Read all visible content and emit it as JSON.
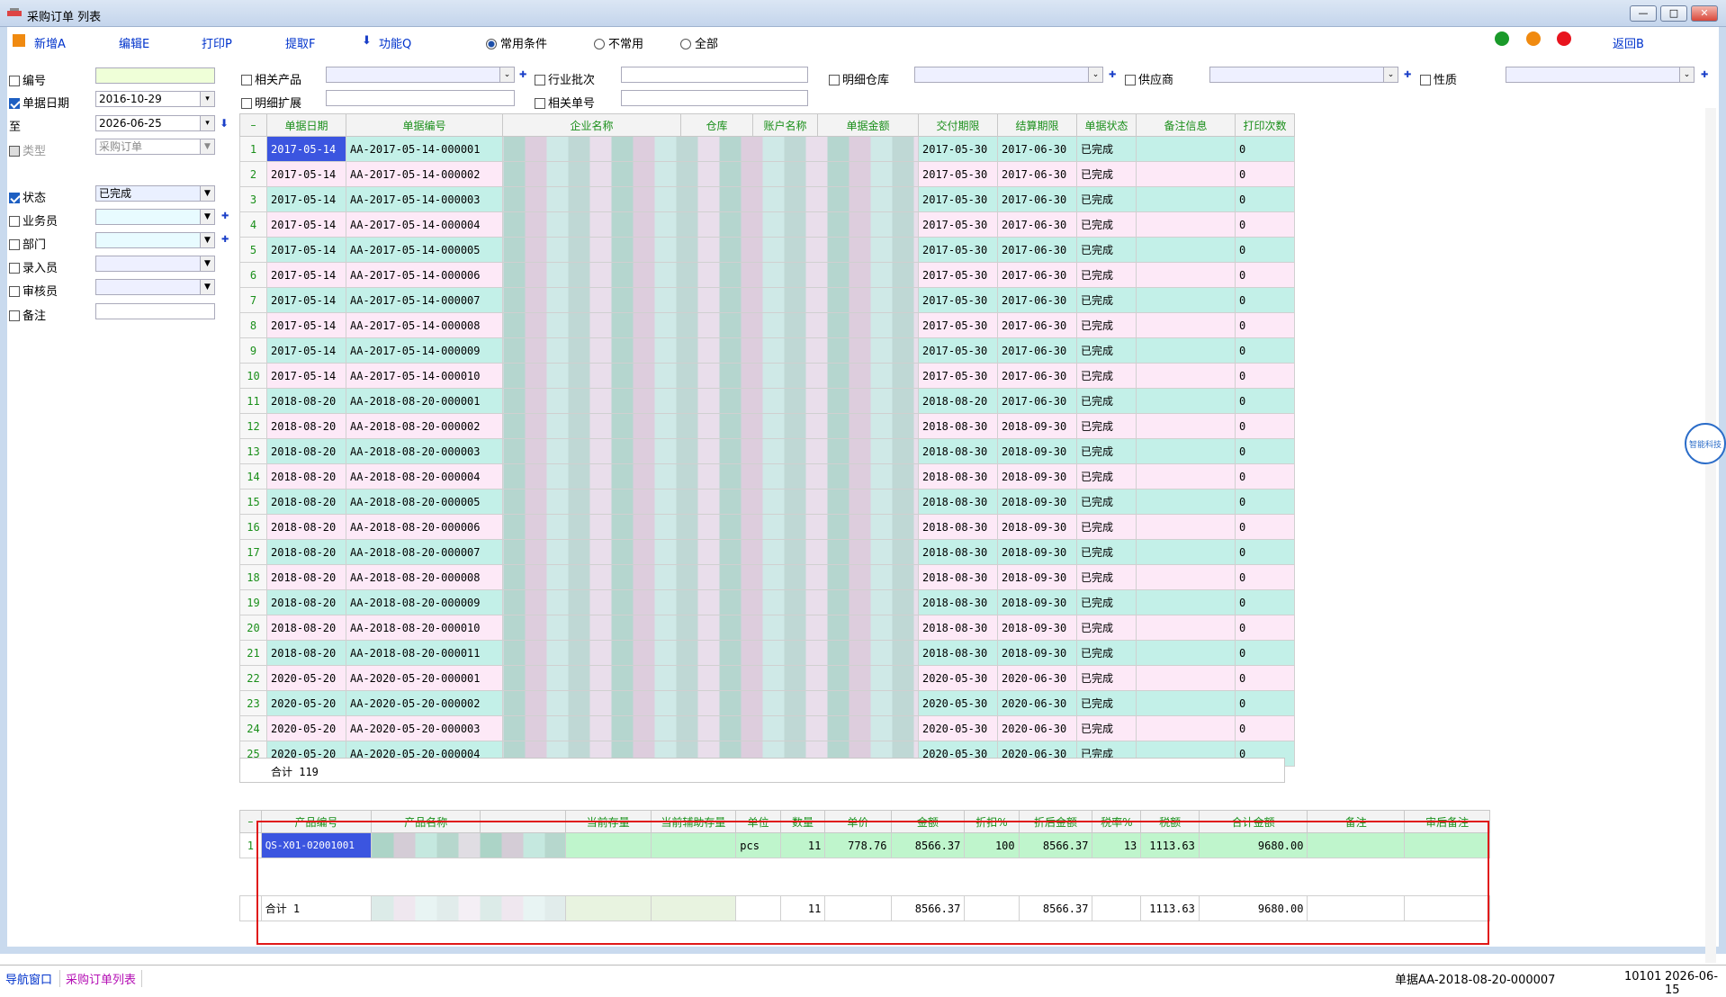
{
  "window": {
    "title": "采购订单 列表",
    "minimize": "—",
    "maximize": "□",
    "close": "✕"
  },
  "toolbar": {
    "new": "新增A",
    "edit": "编辑E",
    "print": "打印P",
    "extract": "提取F",
    "func": "功能Q",
    "back": "返回B",
    "radios": [
      {
        "label": "常用条件",
        "checked": true
      },
      {
        "label": "不常用",
        "checked": false
      },
      {
        "label": "全部",
        "checked": false
      }
    ],
    "dots": [
      "#1a9a2a",
      "#f08a10",
      "#e8141e"
    ]
  },
  "filters": {
    "number": {
      "label": "编号",
      "checked": false,
      "value": ""
    },
    "date": {
      "label": "单据日期",
      "checked": true,
      "from": "2016-10-29",
      "to_label": "至",
      "to": "2026-06-25"
    },
    "type": {
      "label": "类型",
      "value": "采购订单"
    },
    "status": {
      "label": "状态",
      "checked": true,
      "value": "已完成"
    },
    "salesman": {
      "label": "业务员",
      "checked": false
    },
    "dept": {
      "label": "部门",
      "checked": false
    },
    "entry": {
      "label": "录入员",
      "checked": false
    },
    "auditor": {
      "label": "审核员",
      "checked": false
    },
    "remark": {
      "label": "备注",
      "checked": false
    },
    "related_product": "相关产品",
    "industry_batch": "行业批次",
    "detail_warehouse": "明细仓库",
    "supplier": "供应商",
    "nature": "性质",
    "detail_ext": "明细扩展",
    "related_bill": "相关单号"
  },
  "main_grid": {
    "headers": [
      "单据日期",
      "单据编号",
      "企业名称",
      "仓库",
      "账户名称",
      "单据金额",
      "交付期限",
      "结算期限",
      "单据状态",
      "备注信息",
      "打印次数"
    ],
    "rows": [
      [
        "2017-05-14",
        "AA-2017-05-14-000001",
        "2017-05-30",
        "2017-06-30",
        "已完成",
        "0"
      ],
      [
        "2017-05-14",
        "AA-2017-05-14-000002",
        "2017-05-30",
        "2017-06-30",
        "已完成",
        "0"
      ],
      [
        "2017-05-14",
        "AA-2017-05-14-000003",
        "2017-05-30",
        "2017-06-30",
        "已完成",
        "0"
      ],
      [
        "2017-05-14",
        "AA-2017-05-14-000004",
        "2017-05-30",
        "2017-06-30",
        "已完成",
        "0"
      ],
      [
        "2017-05-14",
        "AA-2017-05-14-000005",
        "2017-05-30",
        "2017-06-30",
        "已完成",
        "0"
      ],
      [
        "2017-05-14",
        "AA-2017-05-14-000006",
        "2017-05-30",
        "2017-06-30",
        "已完成",
        "0"
      ],
      [
        "2017-05-14",
        "AA-2017-05-14-000007",
        "2017-05-30",
        "2017-06-30",
        "已完成",
        "0"
      ],
      [
        "2017-05-14",
        "AA-2017-05-14-000008",
        "2017-05-30",
        "2017-06-30",
        "已完成",
        "0"
      ],
      [
        "2017-05-14",
        "AA-2017-05-14-000009",
        "2017-05-30",
        "2017-06-30",
        "已完成",
        "0"
      ],
      [
        "2017-05-14",
        "AA-2017-05-14-000010",
        "2017-05-30",
        "2017-06-30",
        "已完成",
        "0"
      ],
      [
        "2018-08-20",
        "AA-2018-08-20-000001",
        "2018-08-20",
        "2017-06-30",
        "已完成",
        "0"
      ],
      [
        "2018-08-20",
        "AA-2018-08-20-000002",
        "2018-08-30",
        "2018-09-30",
        "已完成",
        "0"
      ],
      [
        "2018-08-20",
        "AA-2018-08-20-000003",
        "2018-08-30",
        "2018-09-30",
        "已完成",
        "0"
      ],
      [
        "2018-08-20",
        "AA-2018-08-20-000004",
        "2018-08-30",
        "2018-09-30",
        "已完成",
        "0"
      ],
      [
        "2018-08-20",
        "AA-2018-08-20-000005",
        "2018-08-30",
        "2018-09-30",
        "已完成",
        "0"
      ],
      [
        "2018-08-20",
        "AA-2018-08-20-000006",
        "2018-08-30",
        "2018-09-30",
        "已完成",
        "0"
      ],
      [
        "2018-08-20",
        "AA-2018-08-20-000007",
        "2018-08-30",
        "2018-09-30",
        "已完成",
        "0"
      ],
      [
        "2018-08-20",
        "AA-2018-08-20-000008",
        "2018-08-30",
        "2018-09-30",
        "已完成",
        "0"
      ],
      [
        "2018-08-20",
        "AA-2018-08-20-000009",
        "2018-08-30",
        "2018-09-30",
        "已完成",
        "0"
      ],
      [
        "2018-08-20",
        "AA-2018-08-20-000010",
        "2018-08-30",
        "2018-09-30",
        "已完成",
        "0"
      ],
      [
        "2018-08-20",
        "AA-2018-08-20-000011",
        "2018-08-30",
        "2018-09-30",
        "已完成",
        "0"
      ],
      [
        "2020-05-20",
        "AA-2020-05-20-000001",
        "2020-05-30",
        "2020-06-30",
        "已完成",
        "0"
      ],
      [
        "2020-05-20",
        "AA-2020-05-20-000002",
        "2020-05-30",
        "2020-06-30",
        "已完成",
        "0"
      ],
      [
        "2020-05-20",
        "AA-2020-05-20-000003",
        "2020-05-30",
        "2020-06-30",
        "已完成",
        "0"
      ],
      [
        "2020-05-20",
        "AA-2020-05-20-000004",
        "2020-05-30",
        "2020-06-30",
        "已完成",
        "0"
      ]
    ],
    "total": "合计 119"
  },
  "detail_grid": {
    "headers": [
      "产品编号",
      "产品名称",
      "",
      "当前存量",
      "当前辅助存量",
      "单位",
      "数量",
      "单价",
      "金额",
      "折扣%",
      "折后金额",
      "税率%",
      "税额",
      "合计金额",
      "备注",
      "审后备注"
    ],
    "row": {
      "code": "QS-X01-02001001",
      "unit": "pcs",
      "qty": "11",
      "price": "778.76",
      "amount": "8566.37",
      "discount": "100",
      "after": "8566.37",
      "rate": "13",
      "tax": "1113.63",
      "total": "9680.00"
    },
    "total": {
      "label": "合计 1",
      "qty": "11",
      "amount": "8566.37",
      "after": "8566.37",
      "tax": "1113.63",
      "total": "9680.00"
    }
  },
  "statusbar": {
    "nav": "导航窗口",
    "tab": "采购订单列表",
    "bill": "单据AA-2018-08-20-000007",
    "code": "10101",
    "date": "2026-06-15"
  },
  "badge": "智能科技"
}
